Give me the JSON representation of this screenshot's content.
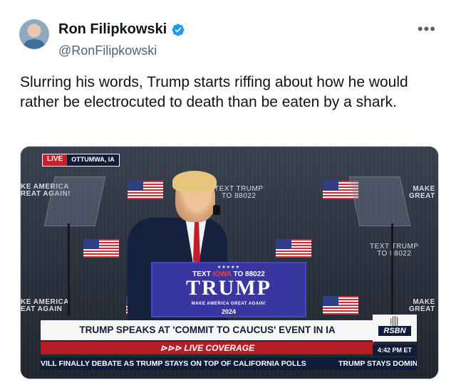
{
  "author": {
    "name": "Ron Filipkowski",
    "handle": "@RonFilipkowski",
    "verified": true,
    "avatar_icon": "avatar"
  },
  "more_icon": "more-icon",
  "tweet_text": "Slurring his words, Trump starts riffing about how he would rather be electrocuted to death than be eaten by a shark.",
  "media": {
    "live_label": "LIVE",
    "location": "OTTUMWA, IA",
    "backdrop_texts": {
      "left_top": "KE AMERICA\nREAT AGAIN!",
      "center_top": "TEXT TRUMP\nTO 88022",
      "right_top": "MAKE\nGREAT",
      "right_mid": "TEXT TRUMP\nTO 88022",
      "left_bottom": "KE AMERICA\nEAT AGAIN",
      "right_bottom": "MAKE\nGREAT"
    },
    "podium": {
      "stars": "★★★★★",
      "text_prefix": "TEXT ",
      "text_highlight": "IOWA",
      "text_suffix": " TO 88022",
      "big": "TRUMP",
      "small": "MAKE AMERICA GREAT AGAIN!",
      "year": "2024"
    },
    "headline": "TRUMP SPEAKS AT 'COMMIT TO CAUCUS' EVENT IN IA",
    "live_coverage": "⊳⊳⊳ LIVE COVERAGE",
    "network": "RSBN",
    "time": "4:42 PM ET",
    "ticker_left": "VILL FINALLY DEBATE AS TRUMP STAYS ON TOP OF CALIFORNIA POLLS",
    "ticker_right": "TRUMP STAYS DOMINANT",
    "colors": {
      "podium": "#3a36a0",
      "live_red": "#c8202b",
      "navy": "#0f1d3a"
    }
  }
}
